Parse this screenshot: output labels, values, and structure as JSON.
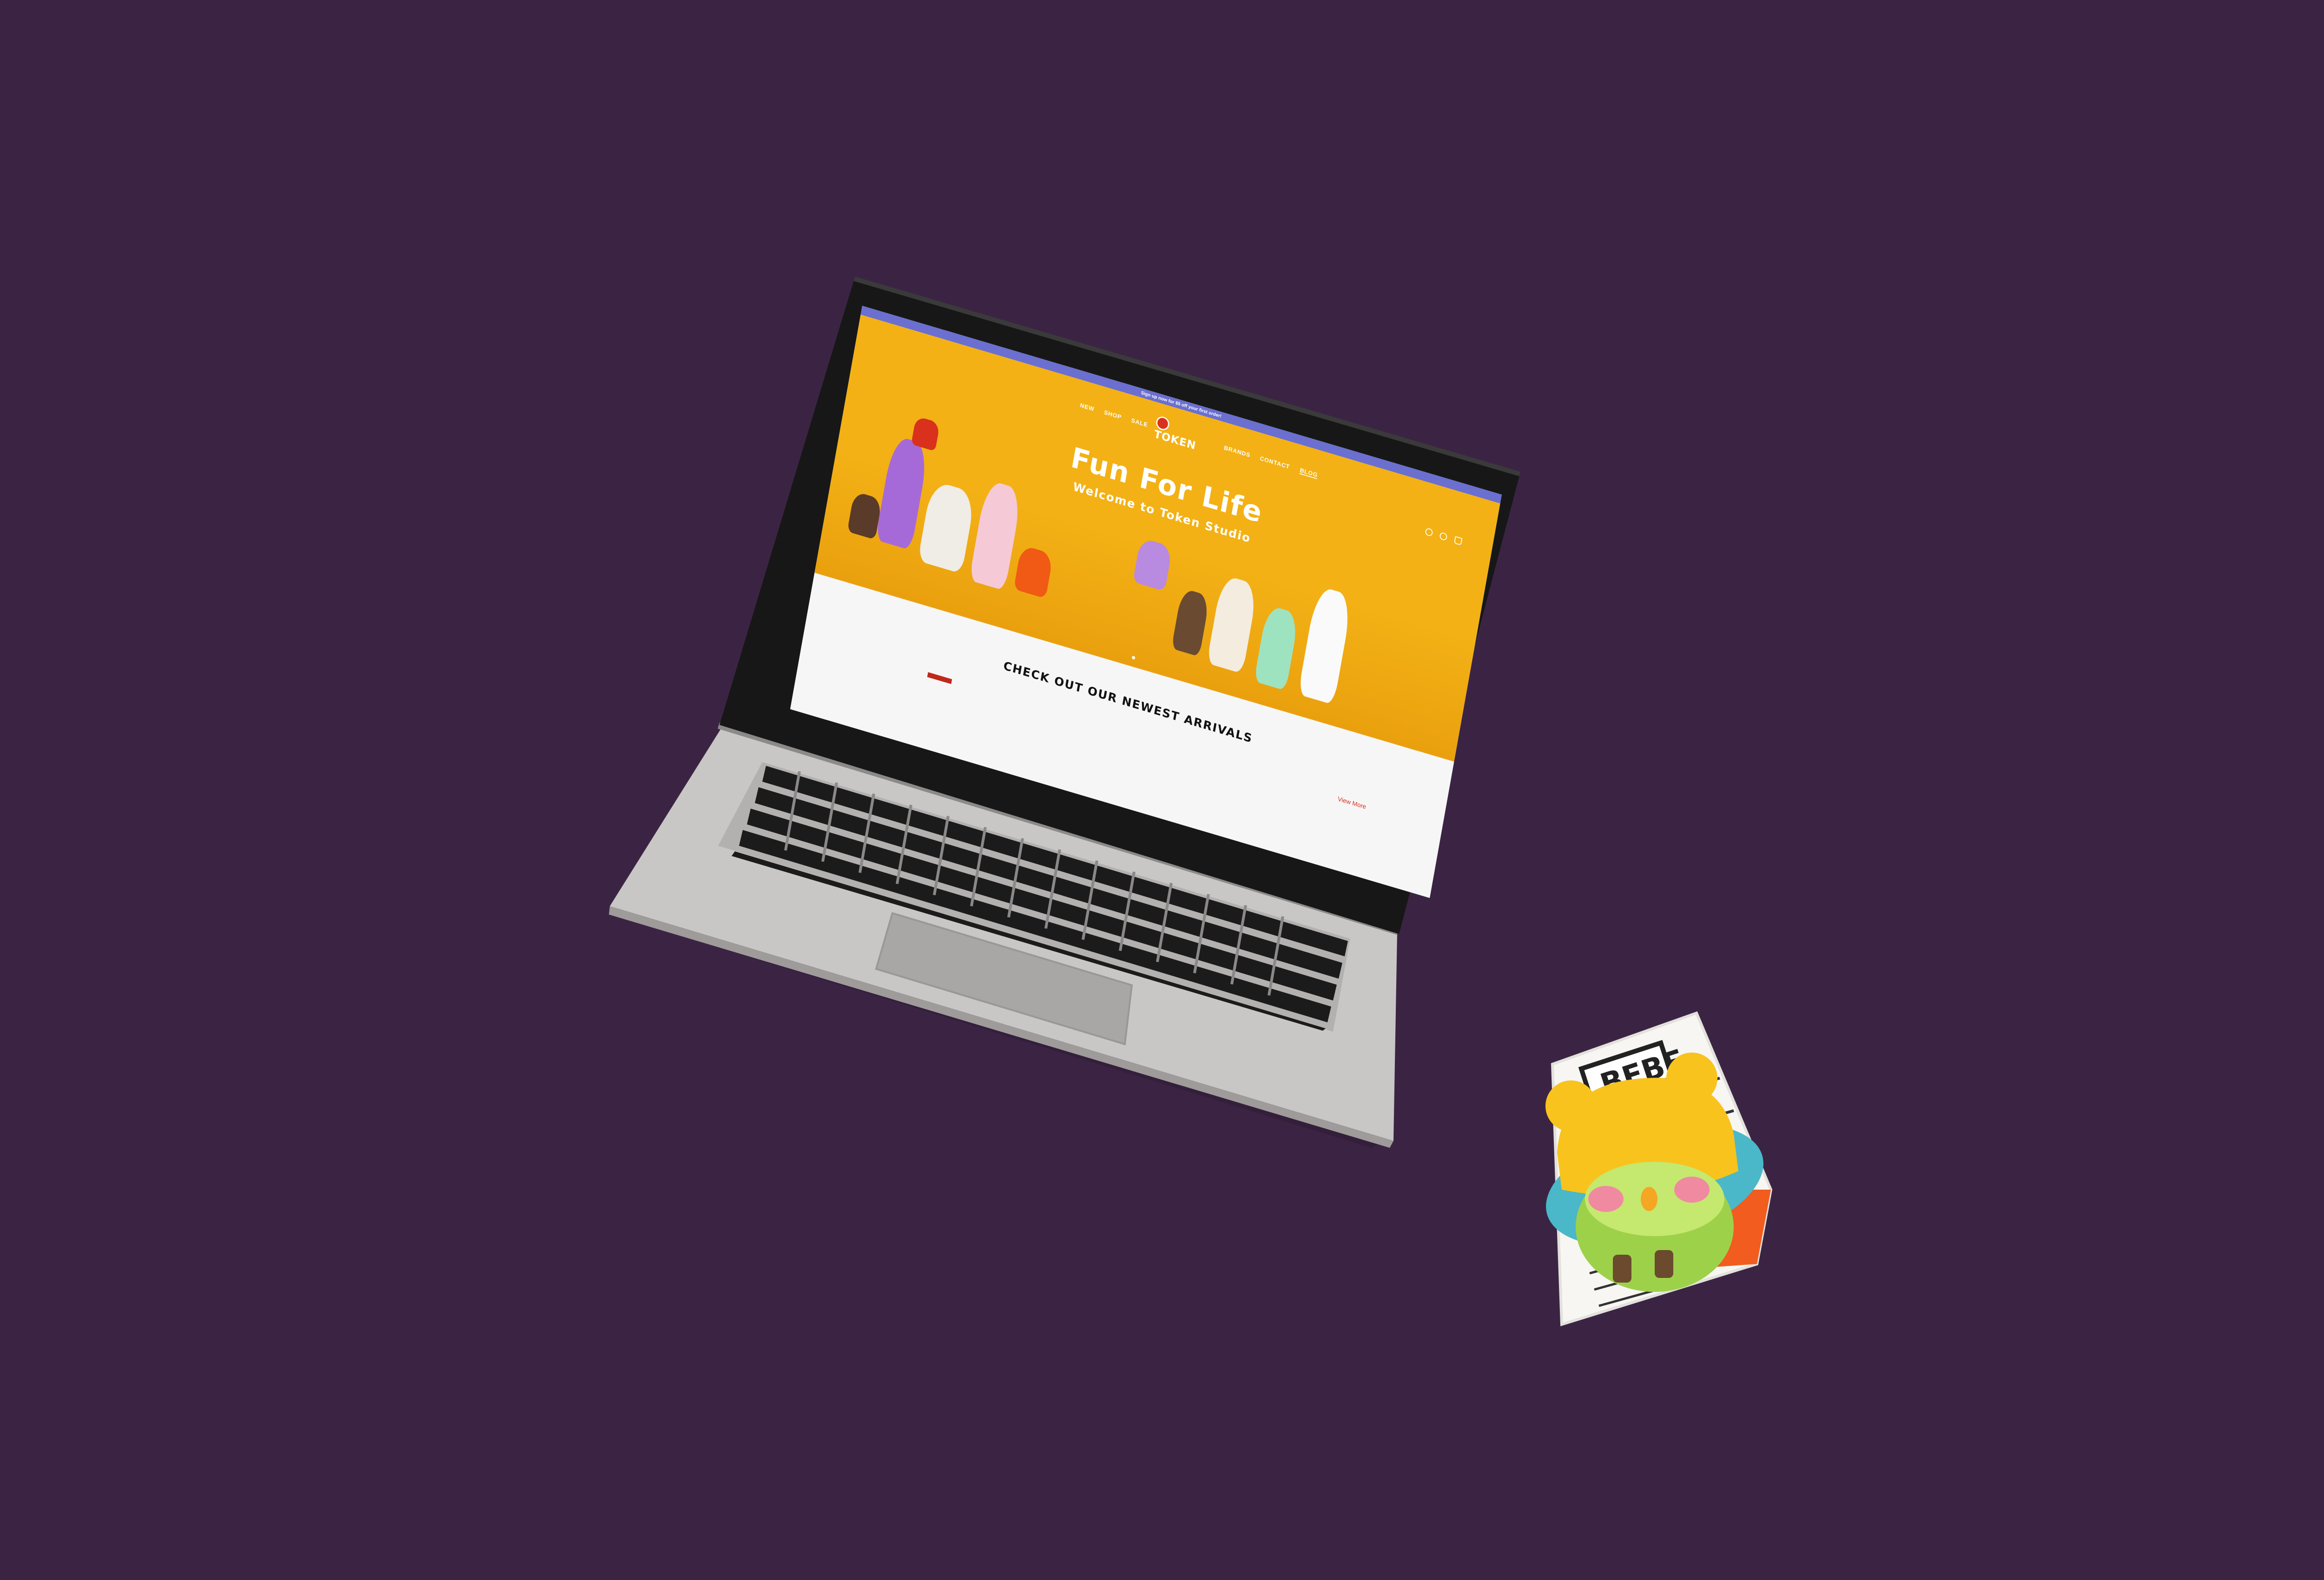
{
  "website": {
    "announcement": "Sign up now for $5 off your first order!",
    "logo_text": "TOKEN",
    "nav": {
      "items": [
        "NEW",
        "SHOP",
        "SALE",
        "BRANDS",
        "CONTACT",
        "BLOG"
      ]
    },
    "icons": [
      "search-icon",
      "account-icon",
      "cart-icon"
    ],
    "hero": {
      "headline": "Fun For Life",
      "subheadline": "Welcome to Token Studio"
    },
    "section": {
      "title": "CHECK OUT OUR NEWEST ARRIVALS",
      "view_more": "View More"
    }
  },
  "colors": {
    "background": "#3b2443",
    "hero_yellow": "#f3b115",
    "announcement_bar": "#6a6fd0",
    "accent_red": "#d9311b",
    "laptop_silver": "#c9c7c6"
  },
  "figure": {
    "sign_text": "BEBE"
  }
}
